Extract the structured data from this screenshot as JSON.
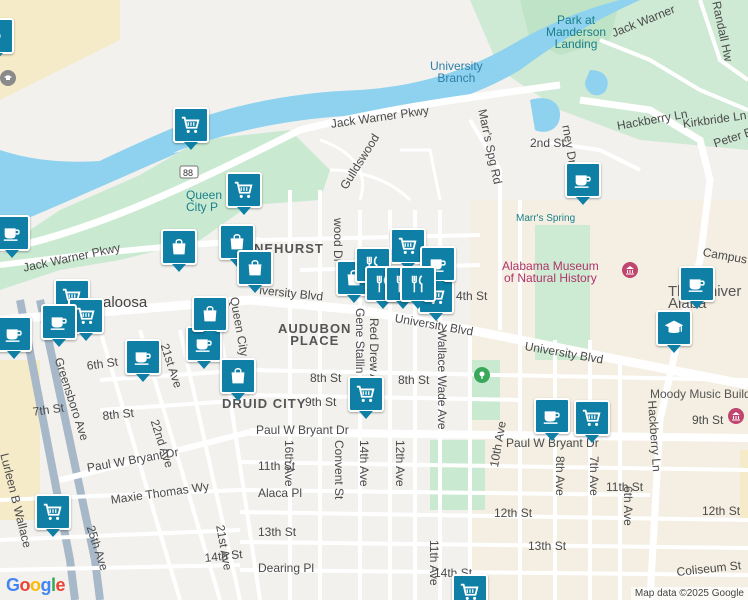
{
  "map": {
    "attribution": "Map data ©2025 Google",
    "logo": "Google",
    "colors": {
      "land": "#f2f1ee",
      "water": "#8ed2ef",
      "park": "#c9ead1",
      "campus": "#f6ebc8",
      "road": "#ffffff",
      "highway": "#a7b8c8",
      "pin": "#0f7fa6"
    }
  },
  "labels": {
    "park_manderson": "Park at\nManderson\nLanding",
    "jack_warner_ne": "Jack Warner",
    "randall_hw": "Randall Hw",
    "university_branch": "University\nBranch",
    "jack_warner_pkwy": "Jack Warner Pkwy",
    "hackberry_ln_top": "Hackberry Ln",
    "kirkbride_ln": "Kirkbride Ln",
    "peter_br": "Peter Br",
    "second_st": "2nd St",
    "marrs_spg_rd": "Marr's Spg Rd",
    "highway_88": "88",
    "queen_city_park": "Queen\nCity P",
    "gulldswood": "Gulldswood",
    "marrs_spring": "Marr's Spring",
    "alabama_museum": "Alabama Museum\nof Natural History",
    "campus_dr": "Campus D",
    "university_of_alabama": "The Univer\nAlaba",
    "jack_warner_pkwy_w": "Jack Warner Pkwy",
    "pinehurst": "NEHURST",
    "university_blvd_w": "iversity Blvd",
    "fourth_st": "4th St",
    "tuscaloosa": "scaloosa",
    "audubon_place": "AUDUBON\nPLACE",
    "university_blvd_c": "University Blvd",
    "university_blvd_e": "University Blvd",
    "sixth_st": "6th St",
    "seventh_st": "7th St",
    "twenty_first_ave": "21st Ave",
    "greensboro_ave": "Greensboro Ave",
    "eighth_st_w": "8th St",
    "eighth_st_c": "8th St",
    "eighth_st_e": "8th St",
    "twenty_second_ave": "22nd Ave",
    "druid_city": "DRUID CITY",
    "ninth_st": "9th St",
    "ninth_st_e": "9th St",
    "moody_music": "Moody Music Buildin",
    "paul_bryant_dr_c": "Paul W Bryant Dr",
    "paul_bryant_dr_e": "Paul W Bryant Dr",
    "paul_bryant_dr_w": "Paul W Bryant Dr",
    "sixteenth_ave": "16th Ave",
    "convent_st": "Convent St",
    "fourteenth_ave": "14th Ave",
    "twelfth_ave": "12th Ave",
    "eleventh_ave": "11th Ave",
    "wallace_wade_ave": "Wallace Wade Ave",
    "tenth_ave": "10th Ave",
    "eighth_ave": "8th Ave",
    "seventh_ave": "7th Ave",
    "sixth_ave": "6th Ave",
    "hackberry_ln": "Hackberry Ln",
    "eleventh_st_c": "11th St",
    "eleventh_st_e": "11th St",
    "maxie_thomas_wy": "Maxie Thomas Wy",
    "alaca_pl": "Alaca Pl",
    "lurleen_wallace": "Lurleen B Wallace",
    "twenty_fifth_ave": "25th Ave",
    "twelfth_st": "12th St",
    "twelfth_st_e": "12th St",
    "thirteenth_st": "13th St",
    "thirteenth_st_e": "13th St",
    "twenty_first_ave_s": "21st Ave",
    "fourteenth_st": "14th St",
    "fourteenth_st_e": "14th St",
    "dearing_pl": "Dearing Pl",
    "coliseum_st": "Coliseum St",
    "red_drew_ave": "Red Drew Ave",
    "gene_stallings": "Gene Stallin",
    "wood_dr": "wood Dr",
    "queen_city_ave": "Queen City",
    "twenty_first_ave_n": "21st Ave"
  },
  "pins": [
    {
      "icon": "shopping-cart",
      "name": "shopping-cart-pin"
    },
    {
      "icon": "coffee-cup",
      "name": "coffee-pin"
    },
    {
      "icon": "shopping-bag",
      "name": "shopping-bag-pin"
    },
    {
      "icon": "restaurant",
      "name": "restaurant-pin"
    },
    {
      "icon": "graduation-cap",
      "name": "school-pin"
    }
  ]
}
